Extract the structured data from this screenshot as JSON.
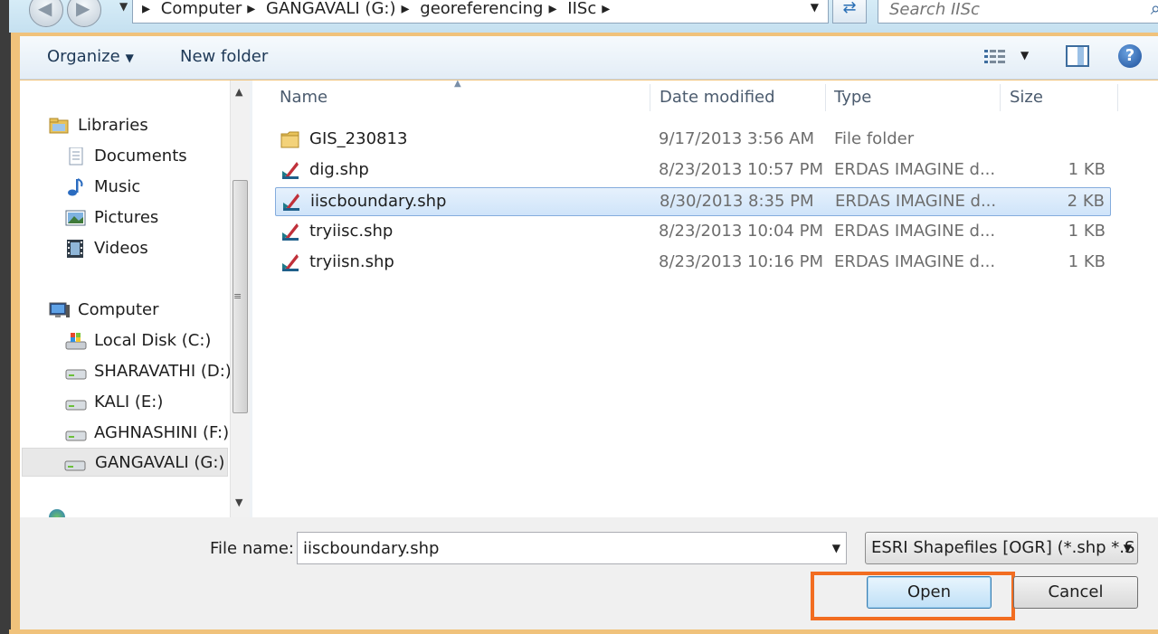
{
  "address": {
    "crumbs": [
      "Computer",
      "GANGAVALI (G:)",
      "georeferencing",
      "IISc"
    ],
    "search_placeholder": "Search IISc"
  },
  "toolbar": {
    "organize_label": "Organize",
    "new_folder_label": "New folder"
  },
  "nav": {
    "libraries": "Libraries",
    "documents": "Documents",
    "music": "Music",
    "pictures": "Pictures",
    "videos": "Videos",
    "computer": "Computer",
    "drive_c": "Local Disk (C:)",
    "drive_d": "SHARAVATHI (D:)",
    "drive_e": "KALI (E:)",
    "drive_f": "AGHNASHINI (F:)",
    "drive_g": "GANGAVALI (G:)"
  },
  "columns": {
    "name": "Name",
    "date": "Date modified",
    "type": "Type",
    "size": "Size"
  },
  "files": [
    {
      "name": "GIS_230813",
      "date": "9/17/2013 3:56 AM",
      "type": "File folder",
      "size": ""
    },
    {
      "name": "dig.shp",
      "date": "8/23/2013 10:57 PM",
      "type": "ERDAS IMAGINE d...",
      "size": "1 KB"
    },
    {
      "name": "iiscboundary.shp",
      "date": "8/30/2013 8:35 PM",
      "type": "ERDAS IMAGINE d...",
      "size": "2 KB"
    },
    {
      "name": "tryiisc.shp",
      "date": "8/23/2013 10:04 PM",
      "type": "ERDAS IMAGINE d...",
      "size": "1 KB"
    },
    {
      "name": "tryiisn.shp",
      "date": "8/23/2013 10:16 PM",
      "type": "ERDAS IMAGINE d...",
      "size": "1 KB"
    }
  ],
  "bottom": {
    "file_name_label": "File name:",
    "file_name_value": "iiscboundary.shp",
    "file_type": "ESRI Shapefiles [OGR] (*.shp *.S",
    "open_label": "Open",
    "cancel_label": "Cancel"
  },
  "colors": {
    "highlight": "#f26d21",
    "selection": "#cfe4fa",
    "frame": "#f0c27b"
  }
}
